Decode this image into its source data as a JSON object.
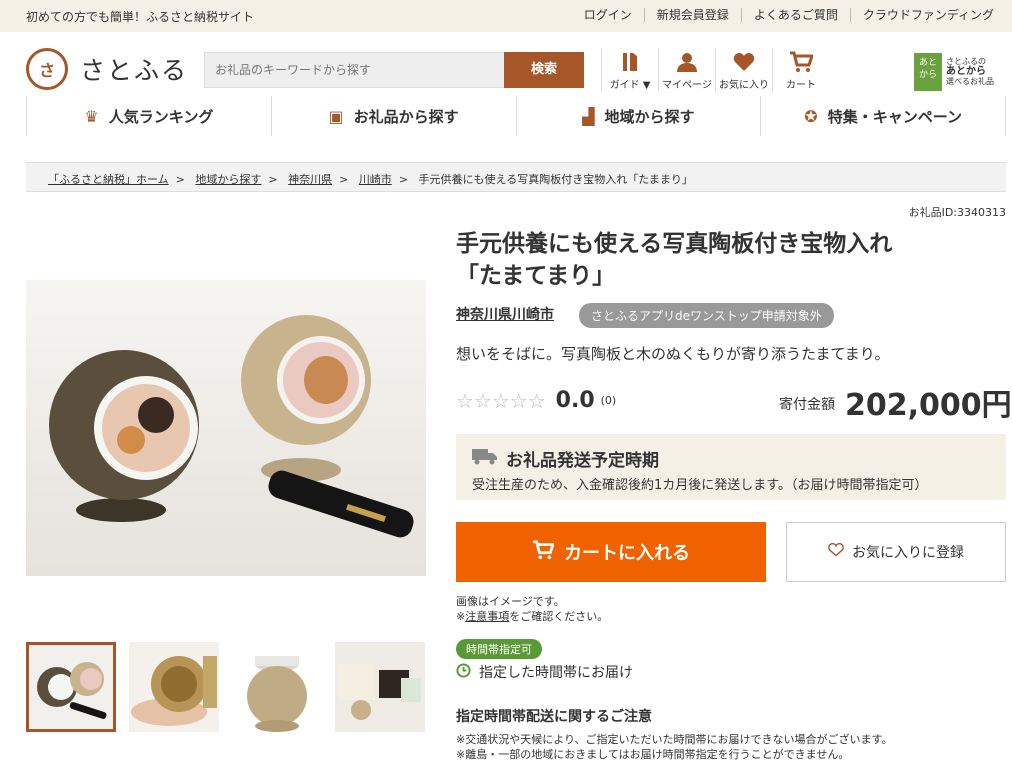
{
  "topbar": {
    "tagline": "初めての方でも簡単！ふるさと納税サイト",
    "links": [
      "ログイン",
      "新規会員登録",
      "よくあるご質問",
      "クラウドファンディング"
    ]
  },
  "header": {
    "logo_mark": "さ",
    "logo_text": "さとふる",
    "search_placeholder": "お礼品のキーワードから探す",
    "search_button": "検索",
    "icons": [
      {
        "label": "ガイド ▼",
        "icon": "book-icon"
      },
      {
        "label": "マイページ",
        "icon": "user-icon"
      },
      {
        "label": "お気に入り",
        "icon": "heart-icon"
      },
      {
        "label": "カート",
        "icon": "cart-icon"
      }
    ],
    "atokara": {
      "box": "あと\nから",
      "line1": "さとふるの",
      "line2": "あとから",
      "line3": "選べるお礼品"
    }
  },
  "catnav": [
    {
      "label": "人気ランキング",
      "icon": "crown-icon"
    },
    {
      "label": "お礼品から探す",
      "icon": "gift-icon"
    },
    {
      "label": "地域から探す",
      "icon": "stairs-icon"
    },
    {
      "label": "特集・キャンペーン",
      "icon": "medal-icon"
    }
  ],
  "breadcrumb": [
    "「ふるさと納税」ホーム",
    "地域から探す",
    "神奈川県",
    "川崎市",
    "手元供養にも使える写真陶板付き宝物入れ「たままり」"
  ],
  "product": {
    "item_id": "お礼品ID:3340313",
    "title_line1": "手元供養にも使える写真陶板付き宝物入れ",
    "title_line2": "「たまてまり」",
    "city": "神奈川県川崎市",
    "badge": "さとふるアプリdeワンストップ申請対象外",
    "catch": "想いをそばに。写真陶板と木のぬくもりが寄り添うたまてまり。",
    "stars": "☆☆☆☆☆",
    "rating": "0.0",
    "review_count": "(0)",
    "price_label": "寄付金額",
    "price": "202,000円",
    "shipping_title": "お礼品発送予定時期",
    "shipping_desc": "受注生産のため、入金確認後約1カ月後に発送します。（お届け時間帯指定可）",
    "cart_button": "カートに入れる",
    "fav_button": "お気に入りに登録",
    "note1": "画像はイメージです。",
    "note2_prefix": "※",
    "note2_link": "注意事項",
    "note2_suffix": "をご確認ください。",
    "time_badge": "時間帯指定可",
    "time_text": "指定した時間帯にお届け",
    "caution_title": "指定時間帯配送に関するご注意",
    "caution1": "※交通状況や天候により、ご指定いただいた時間帯にお届けできない場合がございます。",
    "caution2": "※離島・一部の地域におきましてはお届け時間帯指定を行うことができません。"
  },
  "colors": {
    "brand": "#a5572a",
    "cart": "#f06200",
    "green": "#5a9a35"
  }
}
